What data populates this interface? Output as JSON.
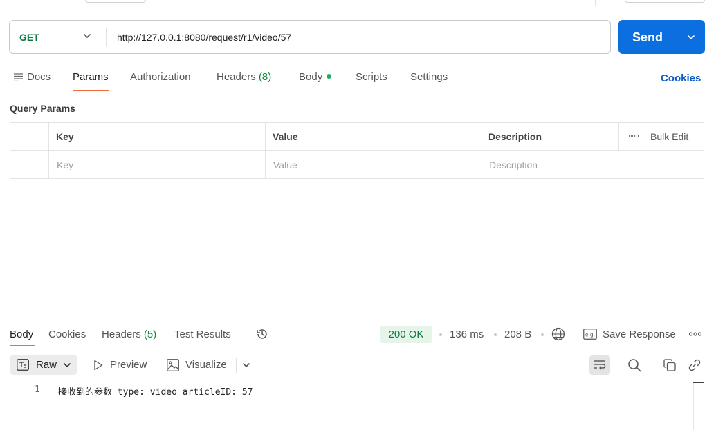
{
  "request": {
    "method": "GET",
    "url": "http://127.0.0.1:8080/request/r1/video/57",
    "send_label": "Send"
  },
  "tabs": {
    "docs": "Docs",
    "params": "Params",
    "authorization": "Authorization",
    "headers": "Headers",
    "headers_count": "(8)",
    "body": "Body",
    "scripts": "Scripts",
    "settings": "Settings",
    "cookies": "Cookies"
  },
  "query_params": {
    "title": "Query Params",
    "columns": [
      "Key",
      "Value",
      "Description"
    ],
    "bulk_edit": "Bulk Edit",
    "placeholders": {
      "key": "Key",
      "value": "Value",
      "description": "Description"
    }
  },
  "response": {
    "tabs": {
      "body": "Body",
      "cookies": "Cookies",
      "headers": "Headers",
      "headers_count": "(5)",
      "test_results": "Test Results"
    },
    "status": "200 OK",
    "time": "136 ms",
    "size": "208 B",
    "save_response": "Save Response",
    "format": "Raw",
    "preview": "Preview",
    "visualize": "Visualize",
    "lines": [
      {
        "number": "1",
        "text": "接收到的参数 type: video articleID: 57"
      }
    ]
  },
  "colors": {
    "accent": "#f26b3a",
    "send": "#0c6fe0",
    "method": "#0b7a3e",
    "link": "#0c5cc4",
    "status_bg": "#e6f4ea"
  },
  "icons": [
    "docs-icon",
    "chevron-down-icon",
    "history-icon",
    "globe-icon",
    "save-response-icon",
    "more-icon",
    "raw-format-icon",
    "play-icon",
    "image-icon",
    "wrap-icon",
    "search-icon",
    "copy-icon",
    "link-icon"
  ]
}
